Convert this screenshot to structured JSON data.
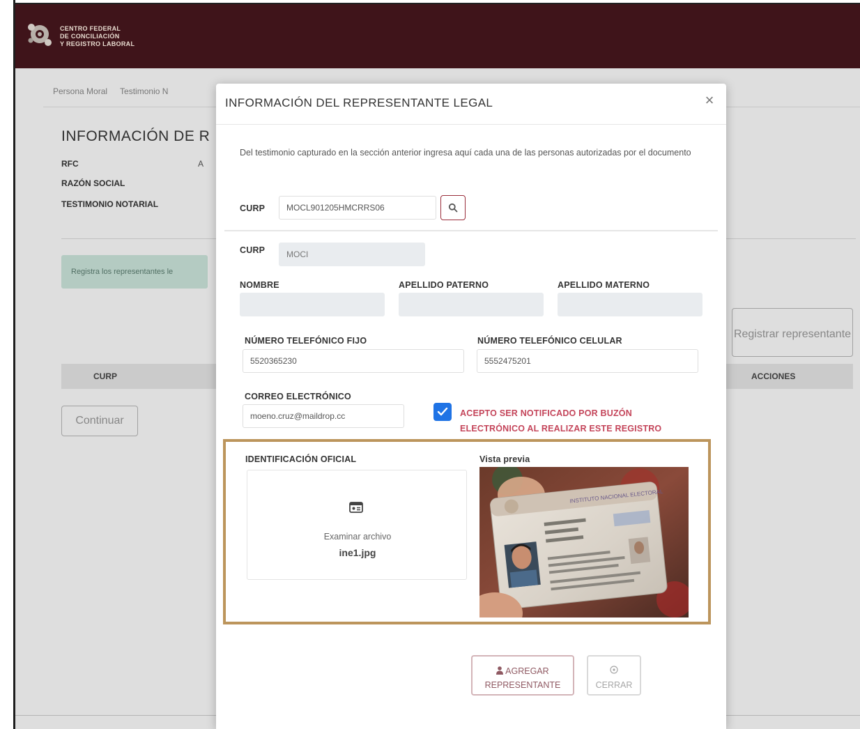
{
  "header": {
    "org_line1": "CENTRO FEDERAL",
    "org_line2": "DE CONCILIACIÓN",
    "org_line3": "Y REGISTRO LABORAL",
    "bg_color": "#3f141a"
  },
  "background": {
    "breadcrumb": [
      "Persona Moral",
      "Testimonio N"
    ],
    "title": "INFORMACIÓN DE R",
    "fields": {
      "rfc": "RFC",
      "rfc_value": "A",
      "razon_social": "RAZÓN SOCIAL",
      "testimonio": "TESTIMONIO NOTARIAL"
    },
    "alert": "Registra los representantes le",
    "register_button": "Registrar representante",
    "table_headers": {
      "curp": "CURP",
      "acciones": "ACCIONES"
    },
    "continue_button": "Continuar"
  },
  "modal": {
    "title": "INFORMACIÓN DEL REPRESENTANTE LEGAL",
    "close_icon": "×",
    "intro": "Del testimonio capturado en la sección anterior ingresa aquí cada una de las personas autorizadas por el documento",
    "search": {
      "label": "CURP",
      "value": "MOCL901205HMCRRS06",
      "icon": "search-icon"
    },
    "person": {
      "curp_label": "CURP",
      "curp_value": "MOCI",
      "nombre_label": "NOMBRE",
      "apellido_paterno_label": "APELLIDO PATERNO",
      "apellido_materno_label": "APELLIDO MATERNO"
    },
    "contact": {
      "tel_fijo_label": "NÚMERO TELEFÓNICO FIJO",
      "tel_fijo_value": "5520365230",
      "tel_celular_label": "NÚMERO TELEFÓNICO CELULAR",
      "tel_celular_value": "5552475201",
      "email_label": "CORREO ELECTRÓNICO",
      "email_value": "moeno.cruz@maildrop.cc"
    },
    "consent": {
      "checked": true,
      "line1": "ACEPTO SER NOTIFICADO POR BUZÓN",
      "line2": "ELECTRÓNICO AL REALIZAR ESTE REGISTRO",
      "color": "#c4455a"
    },
    "identification": {
      "label": "IDENTIFICACIÓN OFICIAL",
      "browse_text": "Examinar archivo",
      "file_name": "ine1.jpg",
      "preview_label": "Vista previa",
      "highlight_color": "#bc955c"
    },
    "buttons": {
      "add_icon": "user-icon",
      "add_line1": "AGREGAR",
      "add_line2": "REPRESENTANTE",
      "close_icon": "circle-x-icon",
      "close_label": "CERRAR"
    }
  }
}
